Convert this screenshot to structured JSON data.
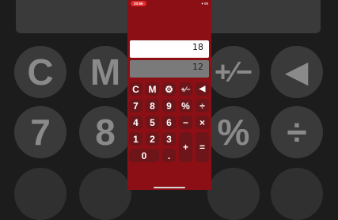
{
  "status": {
    "time": "20:56",
    "icons": "▾ 98"
  },
  "display": {
    "main": "18",
    "secondary": "12"
  },
  "keys": {
    "clear": "C",
    "memory": "M",
    "settings": "⚙",
    "sign": "+⁄−",
    "backspace": "◀",
    "n7": "7",
    "n8": "8",
    "n9": "9",
    "percent": "%",
    "divide": "÷",
    "n4": "4",
    "n5": "5",
    "n6": "6",
    "minus": "−",
    "multiply": "×",
    "n1": "1",
    "n2": "2",
    "n3": "3",
    "plus": "+",
    "equals": "=",
    "n0": "0",
    "decimal": "."
  },
  "background": {
    "clear": "C",
    "memory": "M",
    "sign": "+⁄−",
    "backspace": "◀",
    "n7": "7",
    "n8": "8",
    "percent": "%",
    "divide": "÷"
  },
  "colors": {
    "phone_bg": "#8b0f15",
    "key_bg": "#6e1519",
    "time_pill": "#e02b2b"
  }
}
